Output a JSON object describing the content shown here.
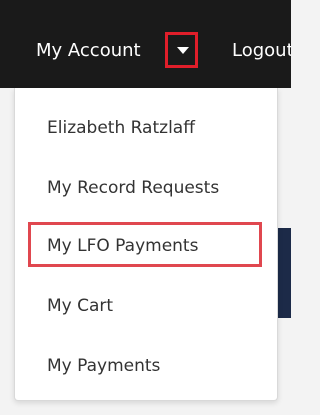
{
  "nav": {
    "account_label": "My Account",
    "logout_label": "Logout"
  },
  "menu": {
    "items": [
      {
        "label": "Elizabeth Ratzlaff"
      },
      {
        "label": "My Record Requests"
      },
      {
        "label": "My LFO Payments"
      },
      {
        "label": "My Cart"
      },
      {
        "label": "My Payments"
      }
    ],
    "highlighted_item": "My LFO Payments"
  },
  "colors": {
    "navbar": "#1a1a1a",
    "annotation_red": "#e01e2a",
    "menu_text": "#333333"
  }
}
